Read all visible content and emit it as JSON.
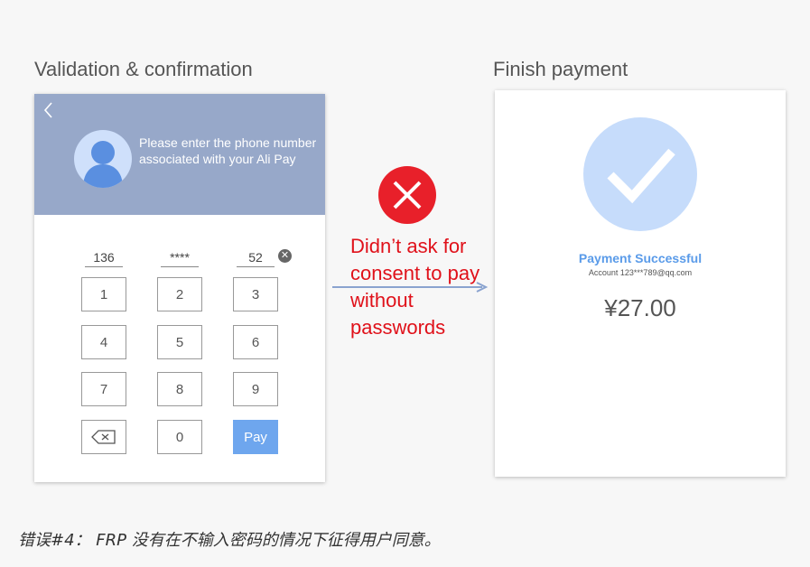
{
  "left_title": "Validation & confirmation",
  "right_title": "Finish payment",
  "left_phone": {
    "prompt": "Please enter the phone number associated with your Ali Pay",
    "phone_parts": [
      "136",
      "****",
      "52"
    ],
    "keys": [
      "1",
      "2",
      "3",
      "4",
      "5",
      "6",
      "7",
      "8",
      "9",
      "0"
    ],
    "pay_label": "Pay",
    "accent_color": "#97a8c9",
    "pay_color": "#6ea6ee"
  },
  "warning": "Didn’t ask for consent to pay without passwords",
  "warning_color": "#e0111a",
  "right_phone": {
    "success_title": "Payment Successful",
    "account": "Account 123***789@qq.com",
    "amount": "¥27.00",
    "success_color": "#5a9be9"
  },
  "caption": "错误#4： FRP 没有在不输入密码的情况下征得用户同意。"
}
